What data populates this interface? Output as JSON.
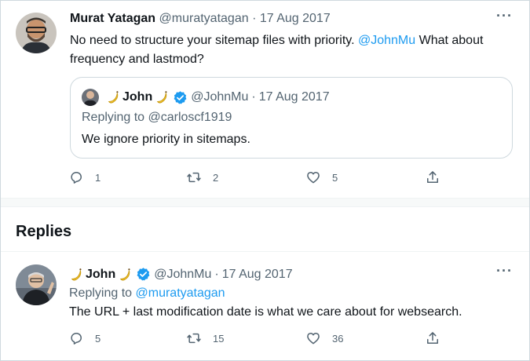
{
  "main_tweet": {
    "author_name": "Murat Yatagan",
    "handle": "@muratyatagan",
    "date_sep": "·",
    "date": "17 Aug 2017",
    "more": "···",
    "text_before": "No need to structure your sitemap files with priority. ",
    "mention": "@JohnMu",
    "text_after": " What about frequency and lastmod?",
    "quoted": {
      "author_name": "John",
      "handle": "@JohnMu",
      "date_sep": "·",
      "date": "17 Aug 2017",
      "replying_to": "Replying to @carloscf1919",
      "text": "We ignore priority in sitemaps."
    },
    "actions": {
      "replies": "1",
      "retweets": "2",
      "likes": "5"
    }
  },
  "replies_header": "Replies",
  "reply_tweet": {
    "author_name": "John",
    "handle": "@JohnMu",
    "date_sep": "·",
    "date": "17 Aug 2017",
    "more": "···",
    "replying_label": "Replying to ",
    "replying_mention": "@muratyatagan",
    "text": "The URL + last modification date is what we care about for websearch.",
    "actions": {
      "replies": "5",
      "retweets": "15",
      "likes": "36"
    }
  },
  "icons": {
    "reply": "reply-icon",
    "retweet": "retweet-icon",
    "like": "heart-icon",
    "share": "share-icon",
    "verified": "verified-badge-icon",
    "emoji": "banana-emoji"
  },
  "colors": {
    "link": "#1d9bf0",
    "muted": "#536471",
    "text": "#0f1419",
    "border": "#cfd9de",
    "verified": "#1d9bf0",
    "banana": "#f4c430"
  }
}
